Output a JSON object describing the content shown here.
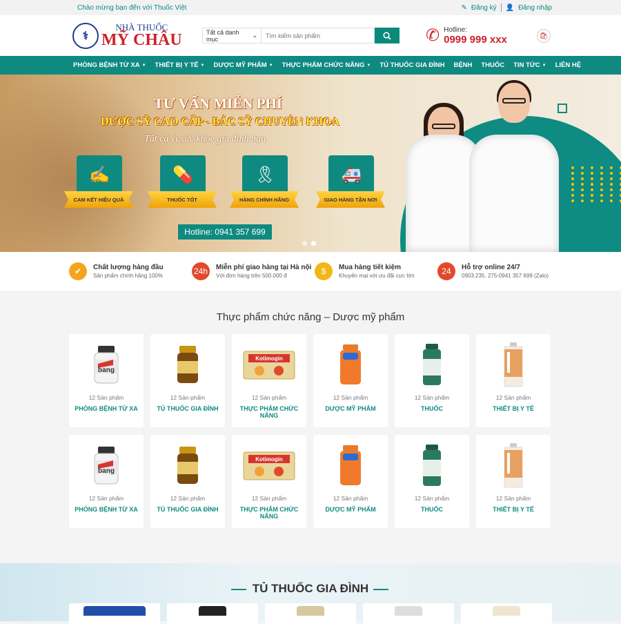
{
  "topbar": {
    "welcome": "Chào mừng bạn đến với Thuốc Việt",
    "register": "Đăng ký",
    "login": "Đăng nhập"
  },
  "logo": {
    "line1": "NHÀ THUỐC",
    "line2": "MỸ CHÂU"
  },
  "search": {
    "category": "Tất cả danh mục",
    "placeholder": "Tìm kiếm sản phẩm"
  },
  "hotline": {
    "label": "Hotline:",
    "number": "0999 999 xxx"
  },
  "nav": {
    "items": [
      "PHÒNG BỆNH TỪ XA",
      "THIẾT BỊ Y TẾ",
      "DƯỢC MỸ PHẨM",
      "THỰC PHẨM CHỨC NĂNG",
      "TỦ THUỐC GIA ĐÌNH",
      "BỆNH",
      "THUỐC",
      "TIN TỨC",
      "LIÊN HỆ"
    ]
  },
  "banner": {
    "title": "TƯ VẤN MIỄN PHÍ",
    "subtitle": "DƯỢC SỸ CAO CẤP - BÁC SỸ CHUYÊN KHOA",
    "slogan": "Tất cả vì sức khỏe gia đình bạn",
    "features": [
      "CAM KẾT HIỆU QUẢ",
      "THUỐC TỐT",
      "HÀNG CHÍNH HÃNG",
      "GIAO HÀNG TẬN NƠI"
    ],
    "hotline": "Hotline: 0941 357 699"
  },
  "benefits": [
    {
      "title": "Chất lượng hàng đầu",
      "sub": "Sản phẩm chính hãng 100%",
      "color": "#f3a51e",
      "icon": "shield-icon"
    },
    {
      "title": "Miễn phí giao hàng tại Hà nội",
      "sub": "Với đơn hàng trên 500.000 đ",
      "color": "#e2492c",
      "icon": "delivery-24h-icon"
    },
    {
      "title": "Mua hàng tiết kiệm",
      "sub": "Khuyến mại với ưu đãi cực lớn",
      "color": "#f2b616",
      "icon": "money-icon"
    },
    {
      "title": "Hỗ trợ online 24/7",
      "sub": "0903.235. 275-0941 357 699 (Zalo)",
      "color": "#e2492c",
      "icon": "phone-24-icon"
    }
  ],
  "section1": {
    "title": "Thực phẩm chức năng – Dược mỹ phẩm"
  },
  "categories": [
    {
      "count": "12 Sản phẩm",
      "name": "PHÒNG BỆNH TỪ XA",
      "label": "bang"
    },
    {
      "count": "12 Sản phẩm",
      "name": "TỦ THUỐC GIA ĐÌNH",
      "label": ""
    },
    {
      "count": "12 Sản phẩm",
      "name": "THỰC PHẨM CHỨC NĂNG",
      "label": "Kotimogin"
    },
    {
      "count": "12 Sản phẩm",
      "name": "DƯỢC MỸ PHẨM",
      "label": ""
    },
    {
      "count": "12 Sản phẩm",
      "name": "THUỐC",
      "label": ""
    },
    {
      "count": "12 Sản phẩm",
      "name": "THIẾT BỊ Y TẾ",
      "label": ""
    }
  ],
  "section2": {
    "title": "TỦ THUỐC GIA ĐÌNH"
  }
}
